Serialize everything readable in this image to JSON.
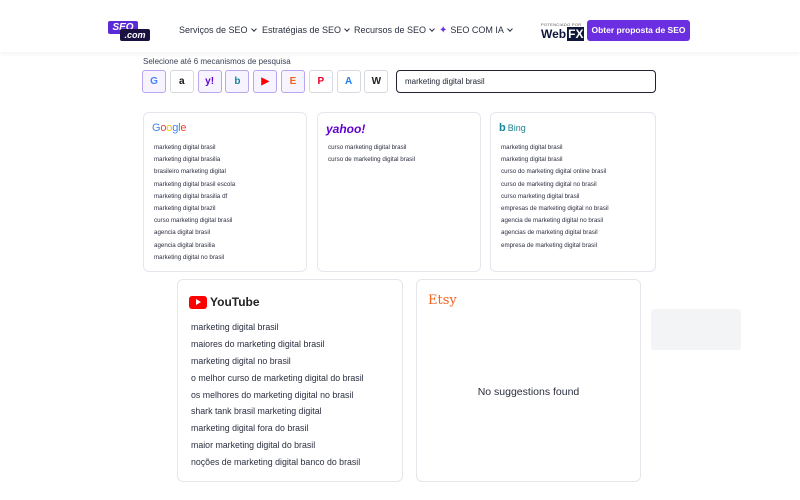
{
  "header": {
    "logo": {
      "seo": "SEO",
      "com": ".com"
    },
    "nav": [
      {
        "label": "Serviços de SEO",
        "icon": "chevron-down-icon"
      },
      {
        "label": "Estratégias de SEO",
        "icon": "chevron-down-icon"
      },
      {
        "label": "Recursos de SEO",
        "icon": "chevron-down-icon"
      },
      {
        "label": "SEO COM IA",
        "icon": "sparkle-icon"
      }
    ],
    "powered_by": "POTENCIADO POR",
    "webfx": {
      "web": "Web",
      "fx": "FX"
    },
    "cta_label": "Obter proposta de SEO"
  },
  "search": {
    "select_label": "Selecione até 6 mecanismos de pesquisa",
    "query": "marketing digital brasil",
    "engines": [
      {
        "name": "google",
        "glyph": "G",
        "color": "#4285f4",
        "selected": true
      },
      {
        "name": "amazon",
        "glyph": "a",
        "color": "#111111",
        "selected": false
      },
      {
        "name": "yahoo",
        "glyph": "y!",
        "color": "#5f01d1",
        "selected": true
      },
      {
        "name": "bing",
        "glyph": "b",
        "color": "#14869a",
        "selected": true
      },
      {
        "name": "youtube",
        "glyph": "▶",
        "color": "#ff0000",
        "selected": true
      },
      {
        "name": "etsy",
        "glyph": "E",
        "color": "#f1641e",
        "selected": true
      },
      {
        "name": "pinterest",
        "glyph": "P",
        "color": "#e60023",
        "selected": false
      },
      {
        "name": "app-store",
        "glyph": "A",
        "color": "#1c7cf4",
        "selected": false
      },
      {
        "name": "wikipedia",
        "glyph": "W",
        "color": "#222222",
        "selected": false
      }
    ]
  },
  "results": {
    "google": {
      "brand": "Google",
      "items": [
        "marketing digital brasil",
        "marketing digital brasilia",
        "brasileiro marketing digital",
        "marketing digital brasil escola",
        "marketing digital brasilia df",
        "marketing digital brazil",
        "curso marketing digital brasil",
        "agencia digital brasil",
        "agencia digital brasilia",
        "marketing digital no brasil"
      ]
    },
    "yahoo": {
      "brand": "yahoo!",
      "items": [
        "curso marketing digital brasil",
        "curso de marketing digital brasil"
      ]
    },
    "bing": {
      "brand": "Bing",
      "items": [
        "marketing digital brasil",
        "marketing digital brasil",
        "curso do marketing digital online brasil",
        "curso de marketing digital no brasil",
        "curso marketing digital brasil",
        "empresas de marketing digital no brasil",
        "agencia de marketing digital no brasil",
        "agencias de marketing digital brasil",
        "empresa de marketing digital brasil"
      ]
    },
    "youtube": {
      "brand": "YouTube",
      "items": [
        "marketing digital brasil",
        "maiores do marketing digital brasil",
        "marketing digital no brasil",
        "o melhor curso de marketing digital do brasil",
        "os melhores do marketing digital no brasil",
        "shark tank brasil marketing digital",
        "marketing digital fora do brasil",
        "maior marketing digital do brasil",
        "noções de marketing digital banco do brasil"
      ]
    },
    "etsy": {
      "brand": "Etsy",
      "empty_message": "No suggestions found"
    }
  }
}
